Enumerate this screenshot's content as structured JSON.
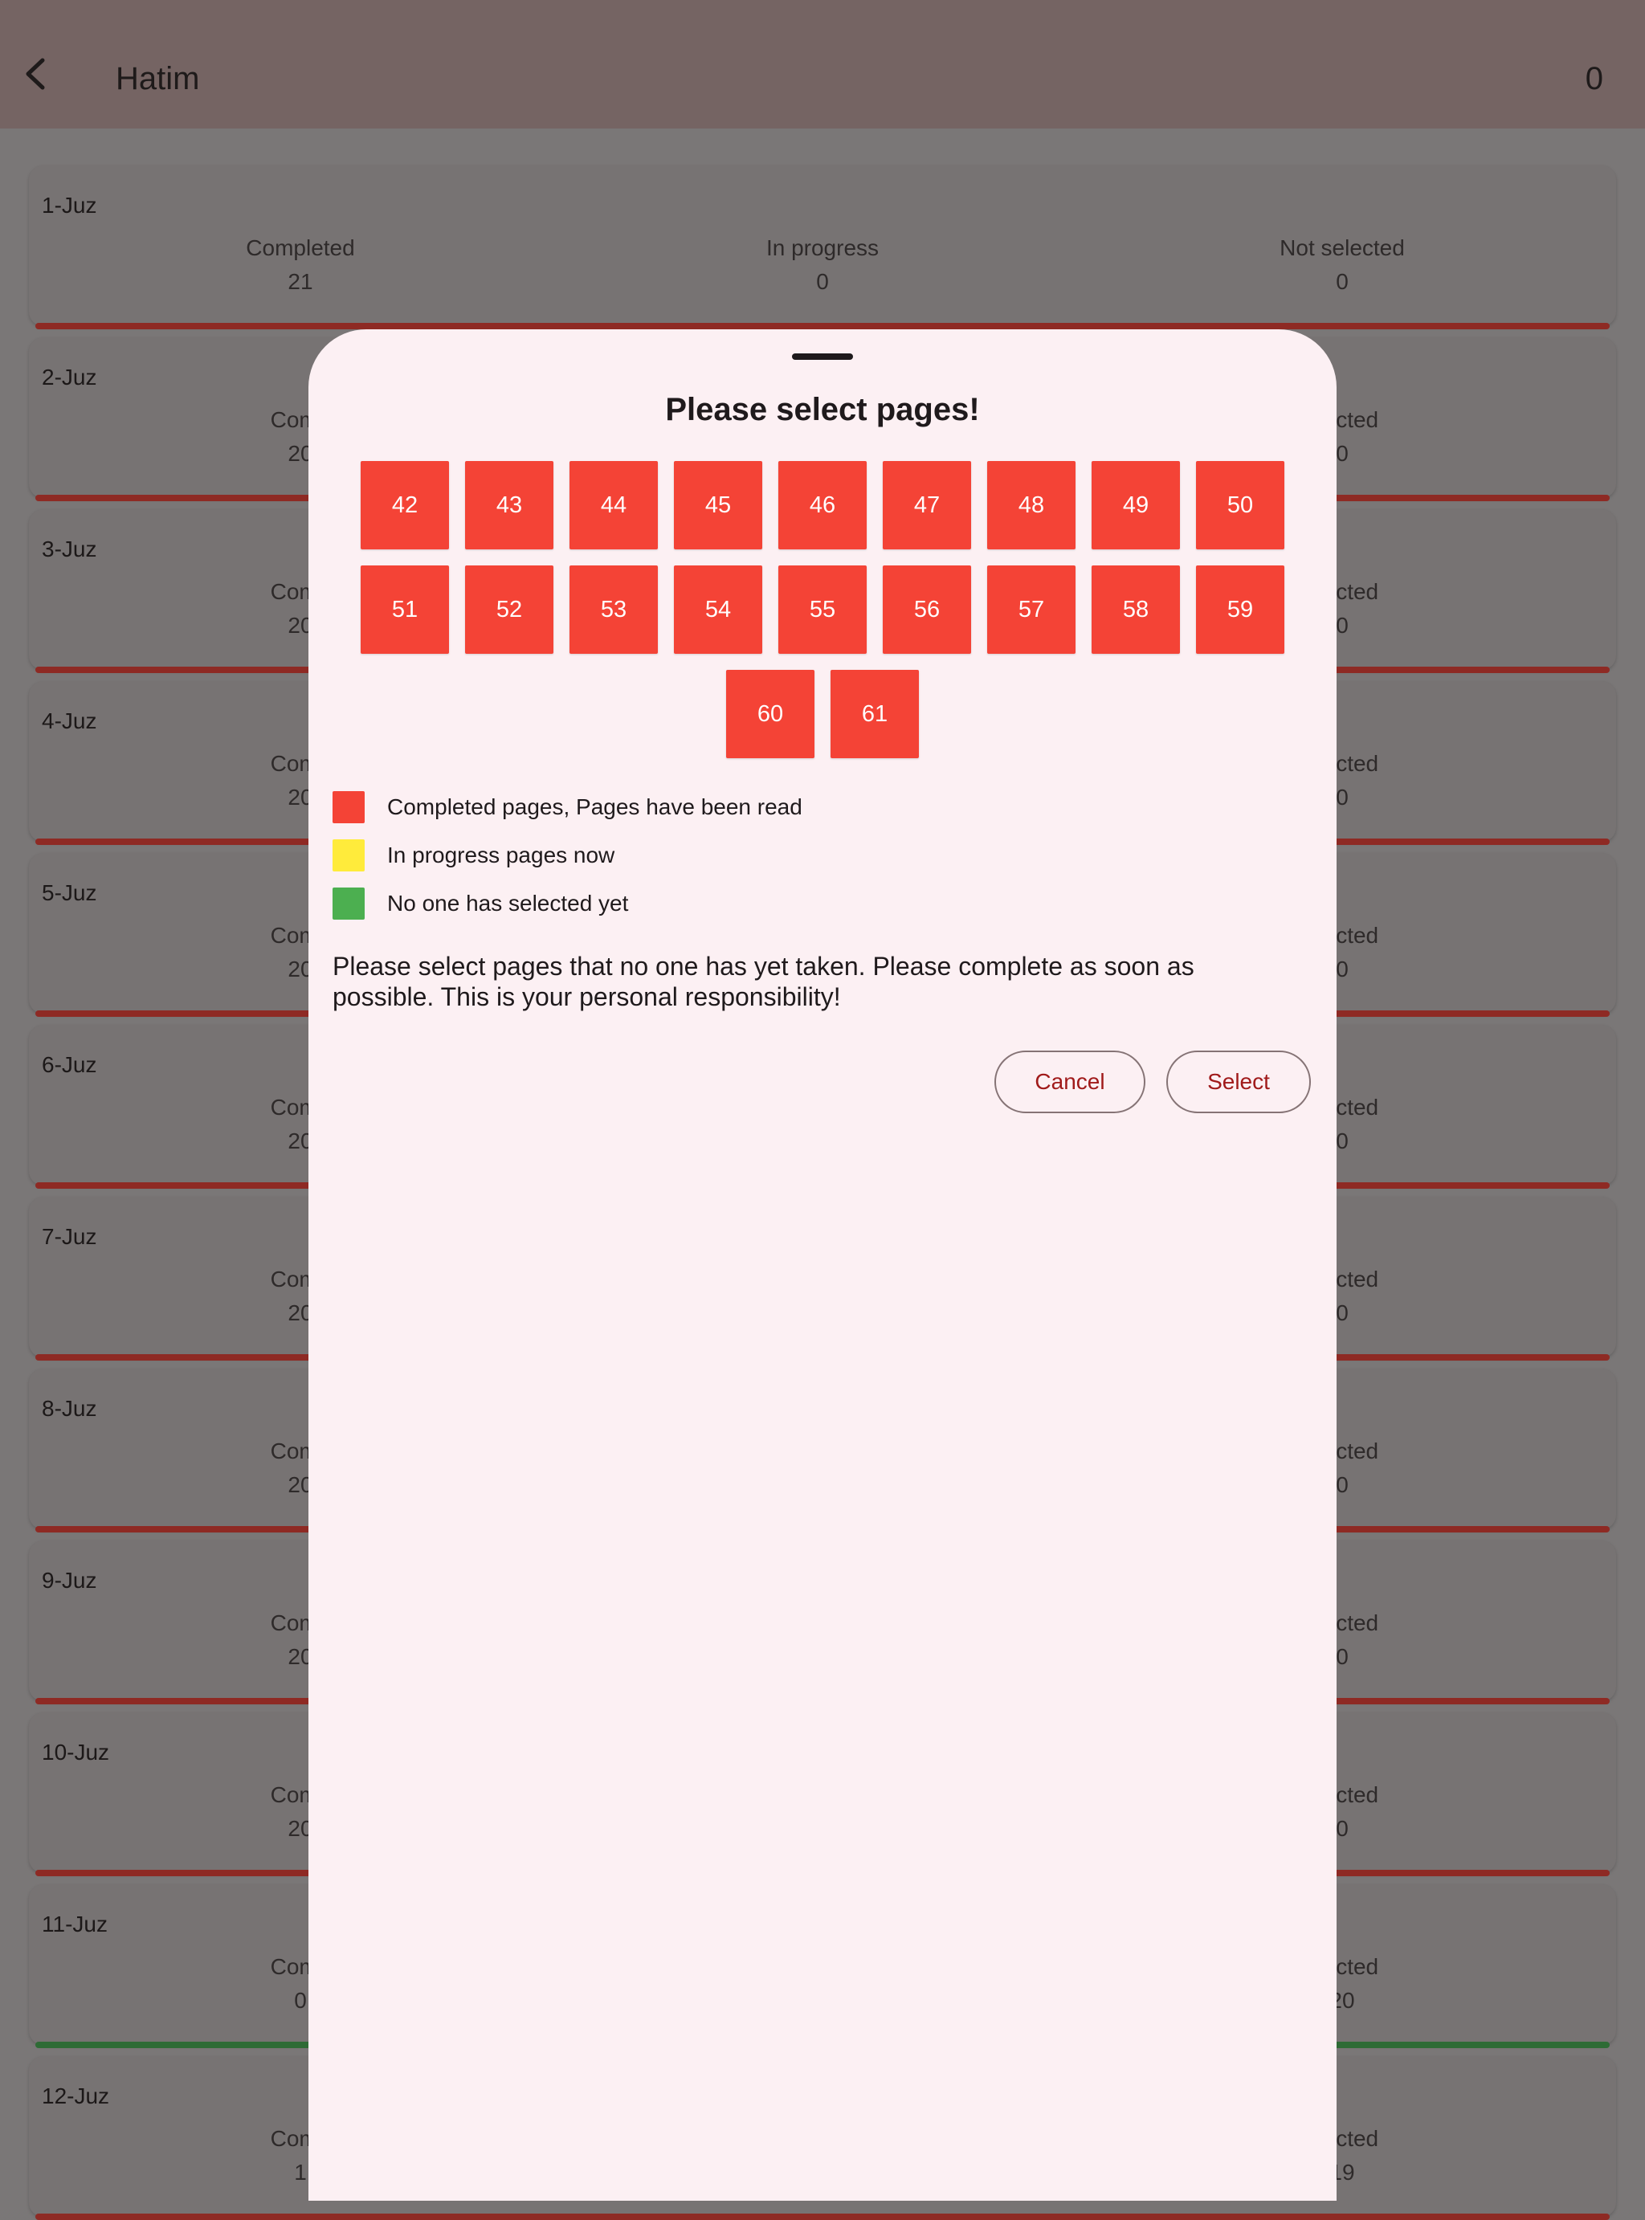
{
  "app_bar": {
    "title": "Hatim",
    "count": "0",
    "back_icon": "chevron-left-icon"
  },
  "juz_list": [
    {
      "name": "1-Juz",
      "completed_label": "Completed",
      "completed": "21",
      "in_progress_label": "In progress",
      "in_progress": "0",
      "not_selected_label": "Not selected",
      "not_selected": "0",
      "bar_color": "#8e2a24"
    },
    {
      "name": "2-Juz",
      "completed_label": "Comp",
      "completed": "20",
      "not_selected_label": "elected",
      "not_selected": "0",
      "bar_color": "#8e2a24"
    },
    {
      "name": "3-Juz",
      "completed_label": "Comp",
      "completed": "20",
      "not_selected_label": "elected",
      "not_selected": "0",
      "bar_color": "#8e2a24"
    },
    {
      "name": "4-Juz",
      "completed_label": "Comp",
      "completed": "20",
      "not_selected_label": "elected",
      "not_selected": "0",
      "bar_color": "#8e2a24"
    },
    {
      "name": "5-Juz",
      "completed_label": "Comp",
      "completed": "20",
      "not_selected_label": "elected",
      "not_selected": "0",
      "bar_color": "#8e2a24"
    },
    {
      "name": "6-Juz",
      "completed_label": "Comp",
      "completed": "20",
      "not_selected_label": "elected",
      "not_selected": "0",
      "bar_color": "#8e2a24"
    },
    {
      "name": "7-Juz",
      "completed_label": "Comp",
      "completed": "20",
      "not_selected_label": "elected",
      "not_selected": "0",
      "bar_color": "#8e2a24"
    },
    {
      "name": "8-Juz",
      "completed_label": "Comp",
      "completed": "20",
      "not_selected_label": "elected",
      "not_selected": "0",
      "bar_color": "#8e2a24"
    },
    {
      "name": "9-Juz",
      "completed_label": "Comp",
      "completed": "20",
      "not_selected_label": "elected",
      "not_selected": "0",
      "bar_color": "#8e2a24"
    },
    {
      "name": "10-Juz",
      "completed_label": "Comp",
      "completed": "20",
      "not_selected_label": "elected",
      "not_selected": "0",
      "bar_color": "#8e2a24"
    },
    {
      "name": "11-Juz",
      "completed_label": "Comp",
      "completed": "0",
      "not_selected_label": "elected",
      "not_selected": "20",
      "bar_color": "#2e6b35"
    },
    {
      "name": "12-Juz",
      "completed_label": "Comp",
      "completed": "1",
      "not_selected_label": "elected",
      "not_selected": "19",
      "bar_color": "#8e2a24"
    }
  ],
  "dialog": {
    "title": "Please select pages!",
    "pages": [
      "42",
      "43",
      "44",
      "45",
      "46",
      "47",
      "48",
      "49",
      "50",
      "51",
      "52",
      "53",
      "54",
      "55",
      "56",
      "57",
      "58",
      "59",
      "60",
      "61"
    ],
    "page_color": "#f44336",
    "legend": [
      {
        "label": "Completed pages, Pages have been read",
        "color": "#f44336"
      },
      {
        "label": "In progress pages now",
        "color": "#ffeb3b"
      },
      {
        "label": "No one has selected yet",
        "color": "#4caf50"
      }
    ],
    "notice": "Please select pages that no one has yet taken. Please complete as soon as possible. This is your personal responsibility!",
    "cancel_label": "Cancel",
    "select_label": "Select"
  }
}
